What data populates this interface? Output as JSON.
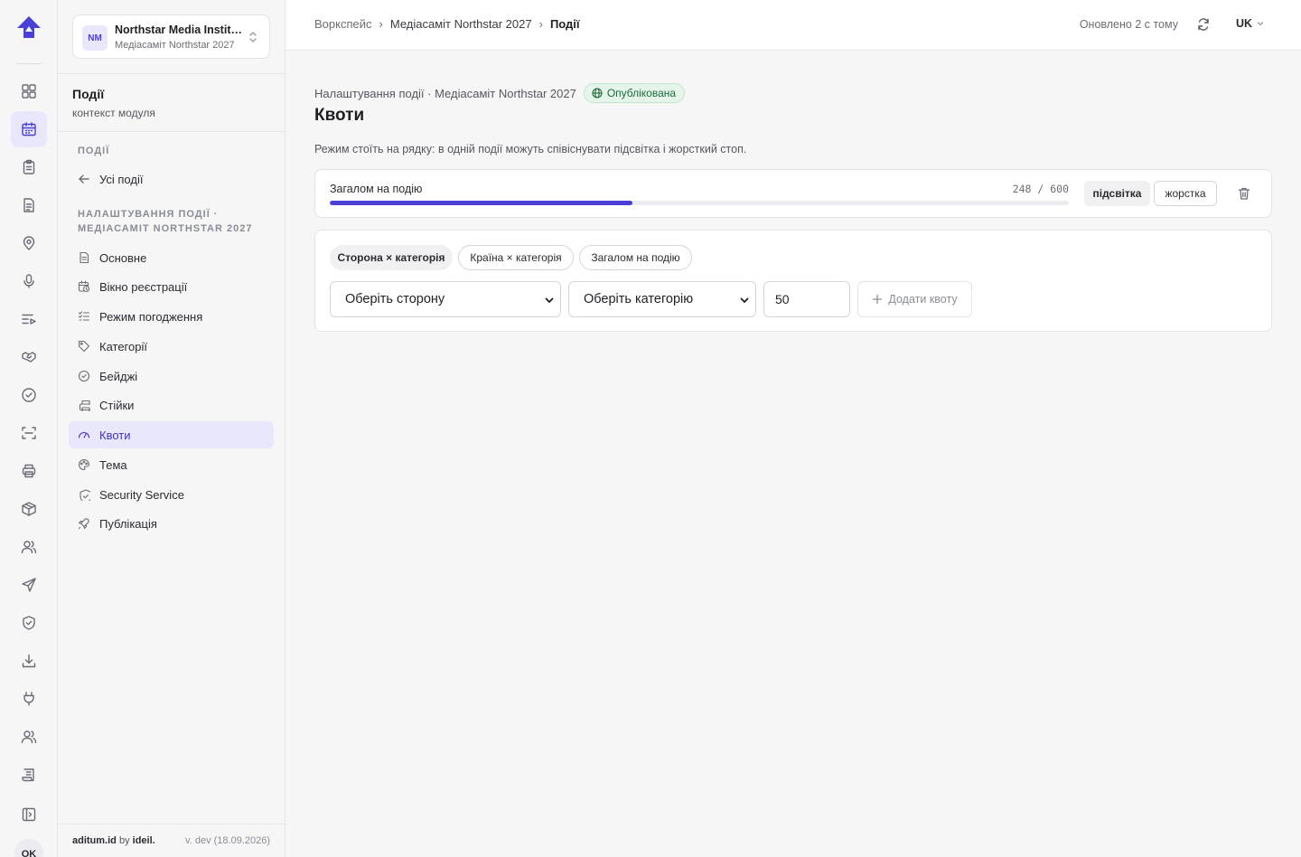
{
  "rail": {
    "active_index": 1,
    "icons": [
      "dashboard-icon",
      "calendar-icon",
      "clipboard-icon",
      "document-icon",
      "map-pin-icon",
      "microphone-icon",
      "agenda-icon",
      "handshake-icon",
      "check-circle-icon",
      "scan-icon",
      "printer-icon",
      "box-icon",
      "users-icon",
      "send-icon",
      "shield-icon",
      "download-icon",
      "plug-icon",
      "team-icon",
      "scroll-icon",
      "sidebar-toggle-icon"
    ],
    "avatar": "OK"
  },
  "org": {
    "badge": "NM",
    "name": "Northstar Media Institute",
    "event": "Медіасаміт Northstar 2027"
  },
  "module": {
    "title": "Події",
    "subtitle": "контекст модуля"
  },
  "sidebar": {
    "section_events": "Події",
    "back_label": "Усі події",
    "section_settings": "Налаштування події · Медіасаміт Northstar 2027",
    "items": [
      {
        "label": "Основне",
        "icon": "file-icon"
      },
      {
        "label": "Вікно реєстрації",
        "icon": "calendar-clock-icon"
      },
      {
        "label": "Режим погодження",
        "icon": "checklist-icon"
      },
      {
        "label": "Категорії",
        "icon": "tag-icon"
      },
      {
        "label": "Бейджі",
        "icon": "badge-icon"
      },
      {
        "label": "Стійки",
        "icon": "printer-icon"
      },
      {
        "label": "Квоти",
        "icon": "gauge-icon"
      },
      {
        "label": "Тема",
        "icon": "palette-icon"
      },
      {
        "label": "Security Service",
        "icon": "shield-icon"
      },
      {
        "label": "Публікація",
        "icon": "rocket-icon"
      }
    ],
    "active_item": 6
  },
  "footer": {
    "brand": "aditum.id",
    "by": "by",
    "maker": "ideil.",
    "version": "v. dev (18.09.2026)"
  },
  "topbar": {
    "breadcrumbs": [
      "Воркспейс",
      "Медіасаміт Northstar 2027",
      "Події"
    ],
    "updated": "Оновлено 2 с тому",
    "lang": "UK"
  },
  "page": {
    "context": "Налаштування події · Медіасаміт Northstar 2027",
    "status": "Опублікована",
    "title": "Квоти",
    "note": "Режим стоїть на рядку: в одній події можуть співіснувати підсвітка і жорсткий стоп."
  },
  "total_quota": {
    "label": "Загалом на подію",
    "used": 248,
    "limit": 600,
    "count_text": "248 / 600",
    "fill_fraction": 0.41,
    "mode_soft": "підсвітка",
    "mode_hard": "жорстка",
    "active_mode": "soft"
  },
  "add_form": {
    "segments": [
      "Сторона × категорія",
      "Країна × категорія",
      "Загалом на подію"
    ],
    "active_segment": 0,
    "side_select": "Оберіть сторону",
    "category_select": "Оберіть категорію",
    "amount": "50",
    "add_button": "Додати квоту"
  },
  "colors": {
    "accent": "#4a40d8",
    "accent_soft": "#e9e7fb",
    "published_bg": "#e5f5ea",
    "published_text": "#1d6b3a"
  }
}
